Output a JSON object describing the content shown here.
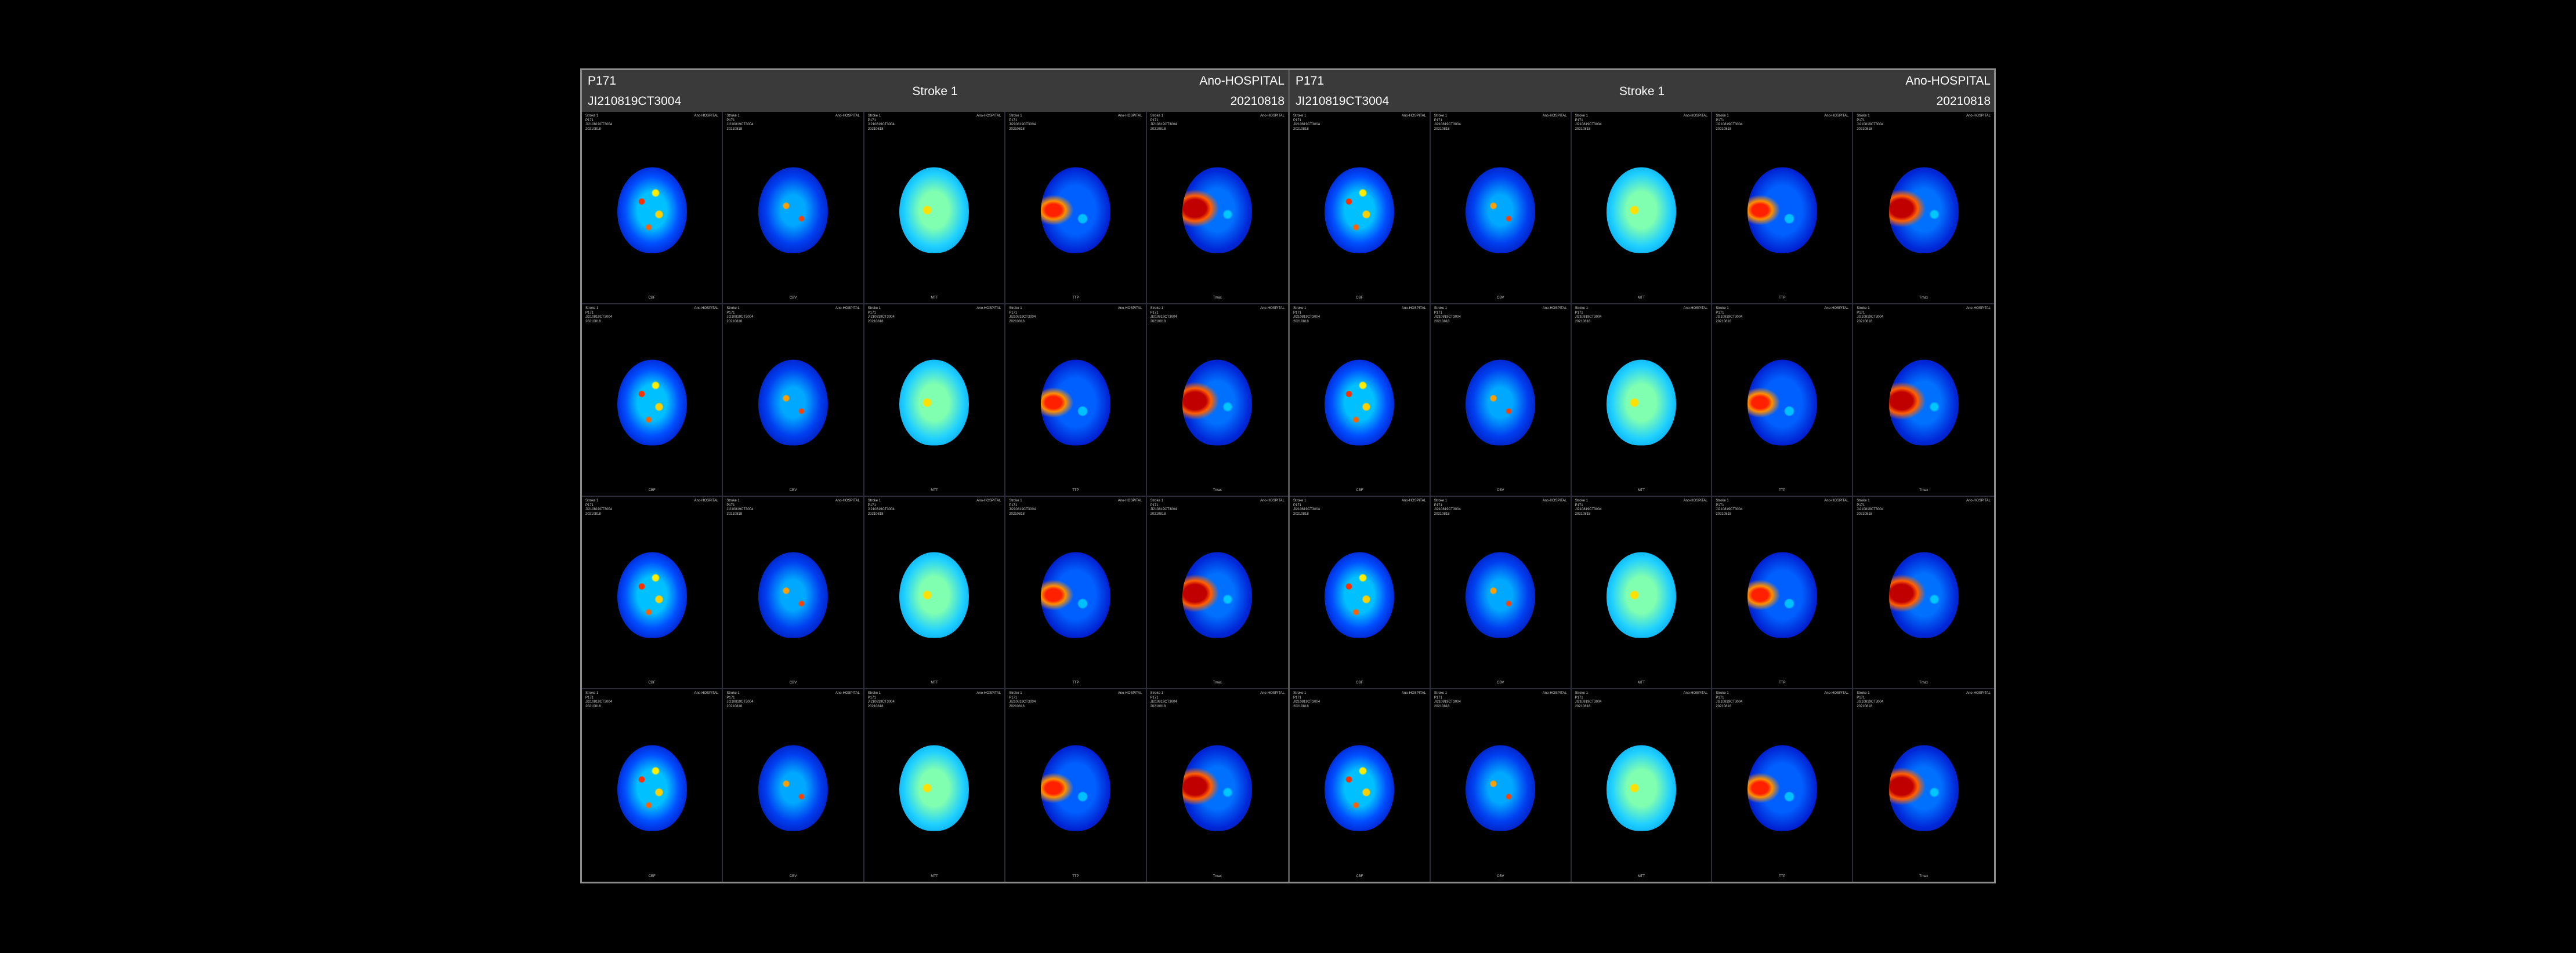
{
  "panels": [
    {
      "patient_id": "P171",
      "study_id": "JI210819CT3004",
      "title": "Stroke 1",
      "hospital": "Ano-HOSPITAL",
      "date": "20210818"
    },
    {
      "patient_id": "P171",
      "study_id": "JI210819CT3004",
      "title": "Stroke 1",
      "hospital": "Ano-HOSPITAL",
      "date": "20210818"
    }
  ],
  "map_columns": [
    "CBF",
    "CBV",
    "MTT",
    "TTP",
    "Tmax"
  ],
  "rows": 4,
  "colors": {
    "header_bg": "#3a3a3a",
    "frame_border": "#8c8c8c",
    "background": "#000000"
  }
}
